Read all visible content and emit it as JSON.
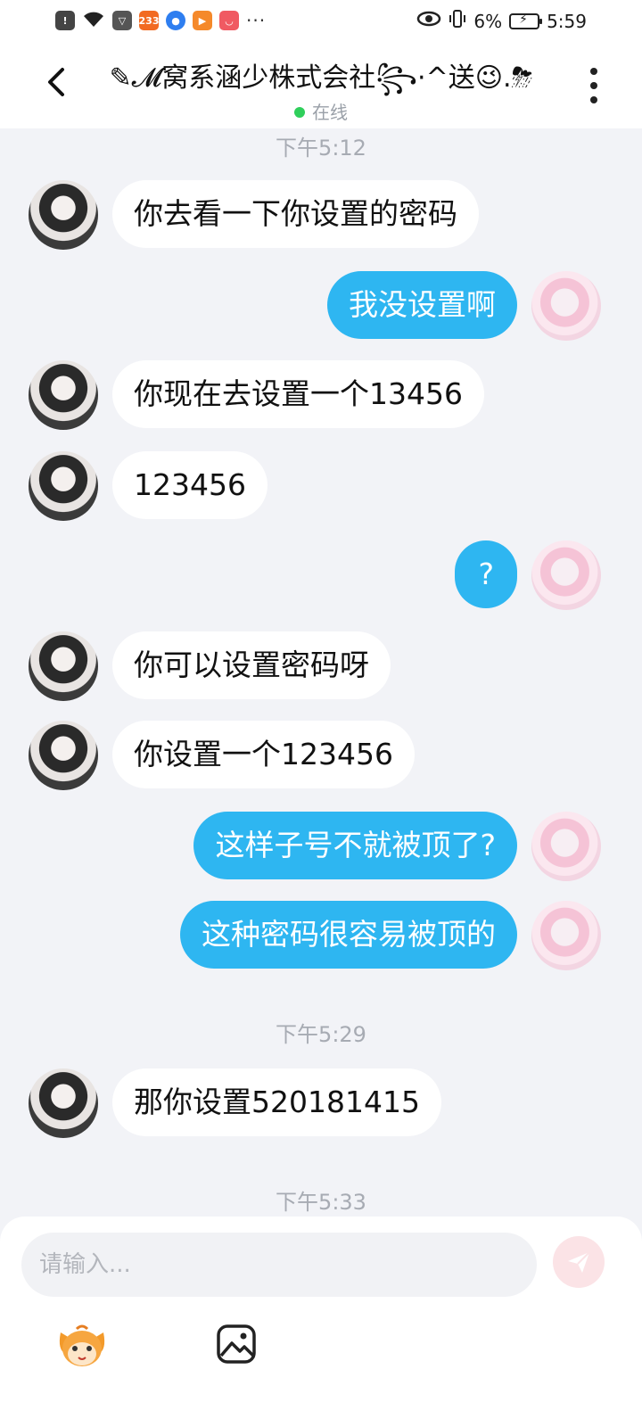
{
  "status_bar": {
    "time": "5:59",
    "battery_percent": "6%",
    "app_icons": [
      "233"
    ]
  },
  "header": {
    "title": "✎𝓜窝系涵少株式会社꧂·^送😉.⛈",
    "status": "在线",
    "back_icon": "chevron-left-icon",
    "more_icon": "more-vertical-icon"
  },
  "timestamps": [
    "下午5:12",
    "下午5:29",
    "下午5:33"
  ],
  "messages": [
    {
      "side": "left",
      "text": "你去看一下你设置的密码"
    },
    {
      "side": "right",
      "text": "我没设置啊"
    },
    {
      "side": "left",
      "text": "你现在去设置一个13456"
    },
    {
      "side": "left",
      "text": "123456"
    },
    {
      "side": "right",
      "text": "?"
    },
    {
      "side": "left",
      "text": "你可以设置密码呀"
    },
    {
      "side": "left",
      "text": "你设置一个123456"
    },
    {
      "side": "right",
      "text": "这样子号不就被顶了?"
    },
    {
      "side": "right",
      "text": "这种密码很容易被顶的"
    },
    {
      "side": "left",
      "text": "那你设置520181415"
    }
  ],
  "composer": {
    "placeholder": "请输入...",
    "send_icon": "send-icon",
    "emoji_icon": "emoji-mascot-icon",
    "image_icon": "image-icon"
  },
  "colors": {
    "my_bubble": "#2eb6f1",
    "their_bubble": "#ffffff",
    "background": "#f2f3f7",
    "online_dot": "#2fcf5b"
  }
}
